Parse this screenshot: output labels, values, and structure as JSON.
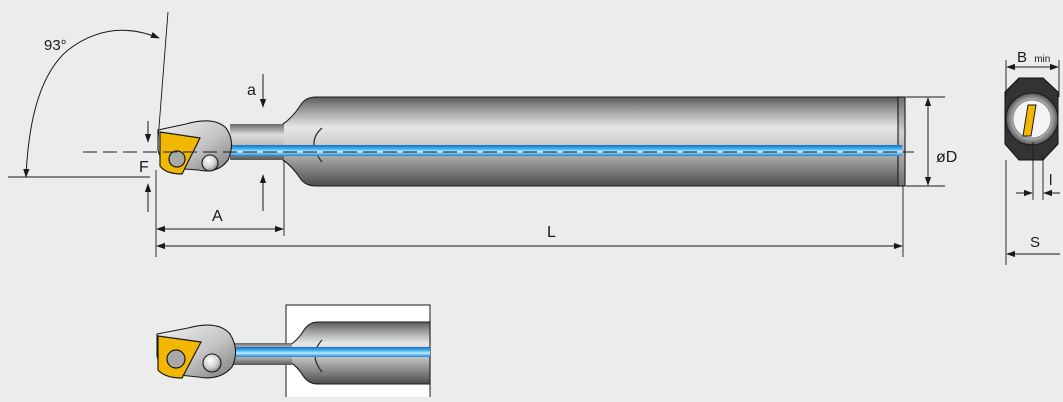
{
  "labels": {
    "angle": "93°",
    "f": "F",
    "a": "a",
    "a_dim": "A",
    "l_dim": "L",
    "d_dim": "øD",
    "b_main": "B",
    "b_sub": "min",
    "l_small": "l",
    "s_dim": "S"
  },
  "colors": {
    "background": "#ececec",
    "shank_dark": "#5f5f5f",
    "shank_light": "#e2e2e2",
    "insert": "#f2b800",
    "coolant": "#2a9fe0",
    "outline": "#1a1a1a"
  }
}
